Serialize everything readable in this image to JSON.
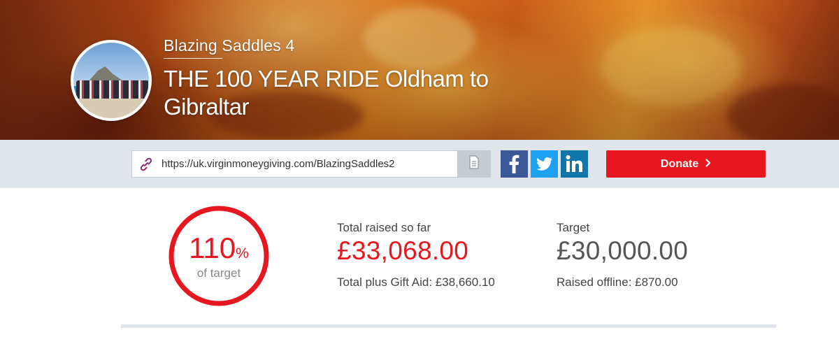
{
  "header": {
    "subtitle": "Blazing Saddles 4",
    "title": "THE 100 YEAR RIDE Oldham to Gibraltar"
  },
  "share": {
    "url": "https://uk.virginmoneygiving.com/BlazingSaddles2",
    "icons": [
      "link-icon",
      "copy-icon",
      "facebook-icon",
      "twitter-icon",
      "linkedin-icon"
    ],
    "facebook_color": "#3b5998",
    "twitter_color": "#1da1f2",
    "linkedin_color": "#0e76a8"
  },
  "donate": {
    "label": "Donate",
    "icon": "chevron-right-icon",
    "color": "#e8161f"
  },
  "progress": {
    "percent": "110",
    "percent_sign": "%",
    "label": "of target",
    "fill_fraction": 1.0
  },
  "raised": {
    "label": "Total raised so far",
    "amount": "£33,068.00",
    "gift_aid": "Total plus Gift Aid: £38,660.10"
  },
  "target": {
    "label": "Target",
    "amount": "£30,000.00",
    "offline": "Raised offline: £870.00"
  }
}
